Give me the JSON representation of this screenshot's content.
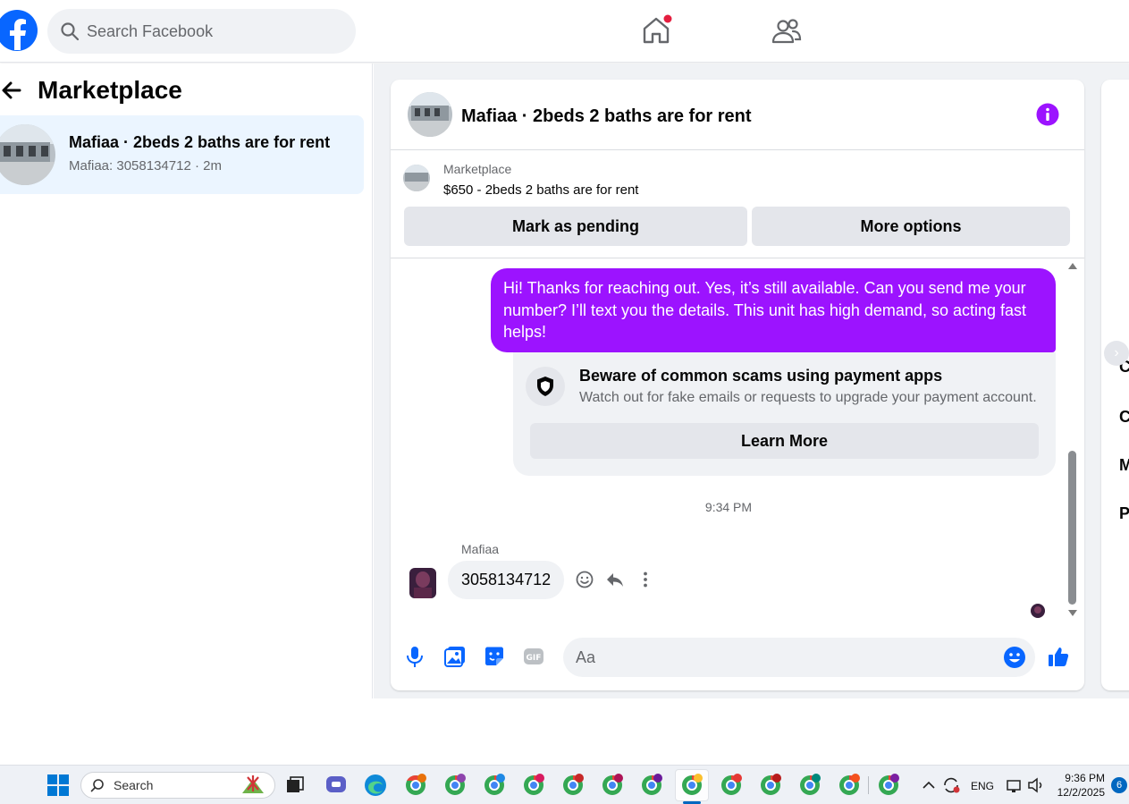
{
  "topbar": {
    "search_placeholder": "Search Facebook"
  },
  "left_panel": {
    "title": "Marketplace",
    "conversation": {
      "title": "Mafiaa · 2beds 2 baths are for rent",
      "subtitle": "Mafiaa: 3058134712 · 2m"
    }
  },
  "chat": {
    "title": "Mafiaa · 2beds 2 baths are for rent",
    "listing": {
      "source": "Marketplace",
      "title": "$650 - 2beds 2 baths are for rent",
      "pending_label": "Mark as pending",
      "more_label": "More options"
    },
    "outgoing_message": "Hi! Thanks for reaching out. Yes, it’s still available. Can you send me your number? I’ll text you the details. This unit has high demand, so acting fast helps!",
    "scam_warning": {
      "title": "Beware of common scams using payment apps",
      "description": "Watch out for fake emails or requests to upgrade your payment account.",
      "button_label": "Learn More"
    },
    "timestamp": "9:34 PM",
    "incoming": {
      "sender": "Mafiaa",
      "message": "3058134712"
    },
    "composer": {
      "placeholder": "Aa"
    }
  },
  "right_panel": {
    "letters": [
      "C",
      "C",
      "M",
      "P"
    ]
  },
  "taskbar": {
    "search_label": "Search",
    "language": "ENG",
    "time": "9:36 PM",
    "date": "12/2/2025",
    "notification_count": "6"
  },
  "colors": {
    "brand_blue": "#0866ff",
    "message_purple": "#9c13ff",
    "gray_bg": "#f0f2f5"
  }
}
